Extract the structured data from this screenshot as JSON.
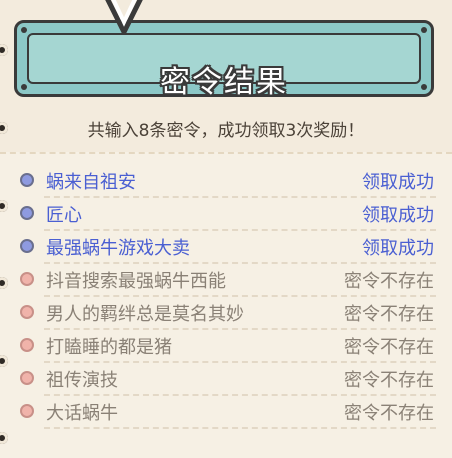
{
  "header": {
    "title": "密令结果",
    "summary": "共输入8条密令，成功领取3次奖励！"
  },
  "results": [
    {
      "code": "蜗来自祖安",
      "status": "领取成功",
      "state": "success"
    },
    {
      "code": "匠心",
      "status": "领取成功",
      "state": "success"
    },
    {
      "code": "最强蜗牛游戏大卖",
      "status": "领取成功",
      "state": "success"
    },
    {
      "code": "抖音搜索最强蜗牛西能",
      "status": "密令不存在",
      "state": "fail"
    },
    {
      "code": "男人的羁绊总是莫名其妙",
      "status": "密令不存在",
      "state": "fail"
    },
    {
      "code": "打瞌睡的都是猪",
      "status": "密令不存在",
      "state": "fail"
    },
    {
      "code": "祖传演技",
      "status": "密令不存在",
      "state": "fail"
    },
    {
      "code": "大话蜗牛",
      "status": "密令不存在",
      "state": "fail"
    }
  ],
  "colors": {
    "success": "#4a5fd2",
    "fail": "#8a8176",
    "banner": "#a5d6d2",
    "paper": "#f3ebdd"
  },
  "icons": {
    "success_marker": "blue-dot-icon",
    "fail_marker": "pink-dot-icon",
    "pin": "pushpin-icon"
  }
}
